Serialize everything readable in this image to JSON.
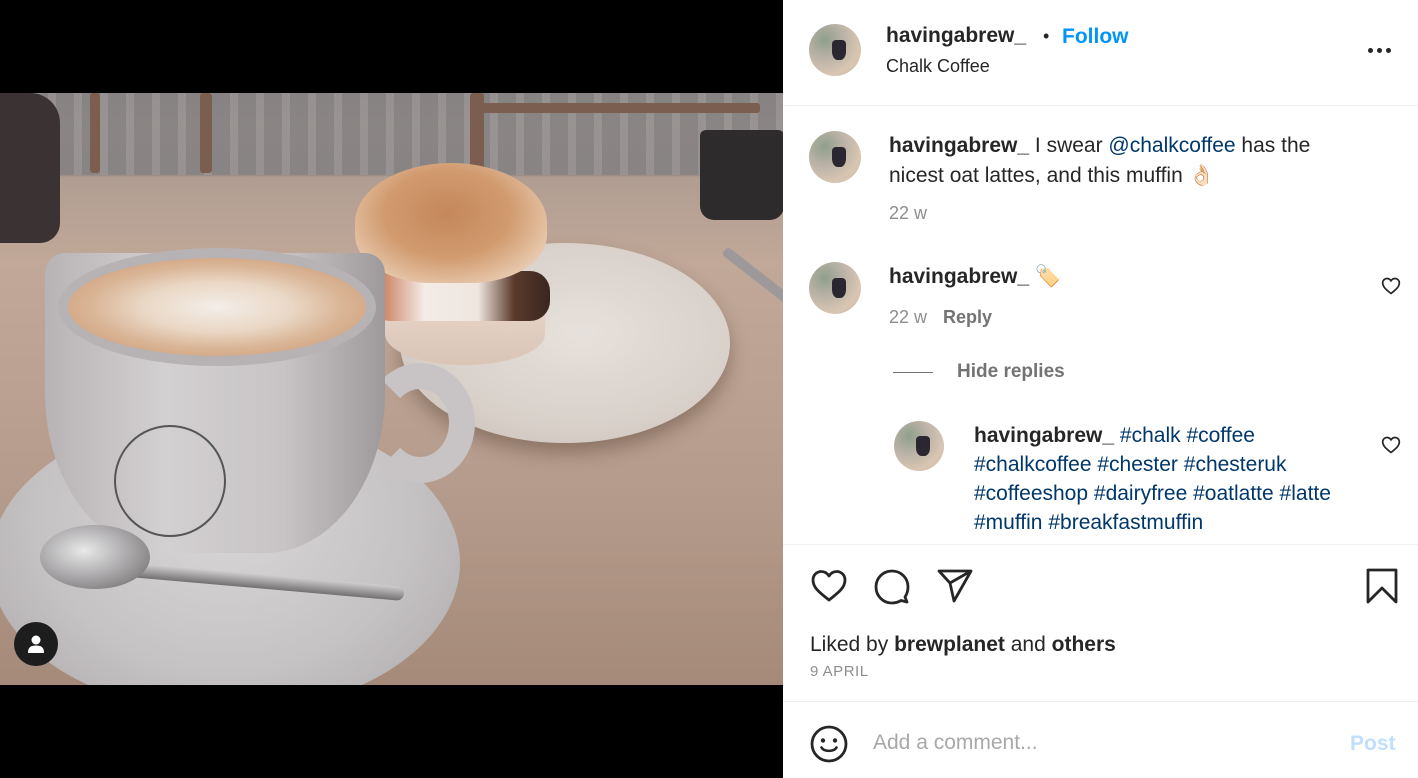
{
  "post": {
    "photo_alt": "Latte with rosetta art in a white cup next to a breakfast muffin on a plate",
    "tagged_users_icon": "person-icon"
  },
  "header": {
    "username": "havingabrew_",
    "separator": "•",
    "follow_label": "Follow",
    "location": "Chalk Coffee",
    "more_icon": "more-horizontal-icon"
  },
  "caption": {
    "username": "havingabrew_",
    "text_before": " I swear ",
    "mention": "@chalkcoffee",
    "text_after": " has the nicest oat lattes, and this muffin ",
    "emoji": "👌🏻",
    "time": "22 w"
  },
  "comments": [
    {
      "username": "havingabrew_",
      "emoji": "🏷️",
      "time": "22 w",
      "reply_label": "Reply",
      "hide_replies_label": "Hide replies",
      "replies": [
        {
          "username": "havingabrew_",
          "hashtags": [
            "#chalk",
            "#coffee",
            "#chalkcoffee",
            "#chester",
            "#chesteruk",
            "#coffeeshop",
            "#dairyfree",
            "#oatlatte",
            "#latte",
            "#muffin",
            "#breakfastmuffin"
          ]
        }
      ]
    }
  ],
  "actions": {
    "like_icon": "heart-icon",
    "comment_icon": "comment-icon",
    "share_icon": "share-icon",
    "save_icon": "bookmark-icon"
  },
  "likes": {
    "prefix": "Liked by ",
    "user": "brewplanet",
    "middle": " and ",
    "others": "others"
  },
  "date": "9 APRIL",
  "composer": {
    "placeholder": "Add a comment...",
    "value": "",
    "post_label": "Post"
  },
  "colors": {
    "follow_blue": "#0095f6",
    "link_navy": "#00376b",
    "secondary_text": "#8e8e8e",
    "post_disabled": "#c0dffd"
  }
}
